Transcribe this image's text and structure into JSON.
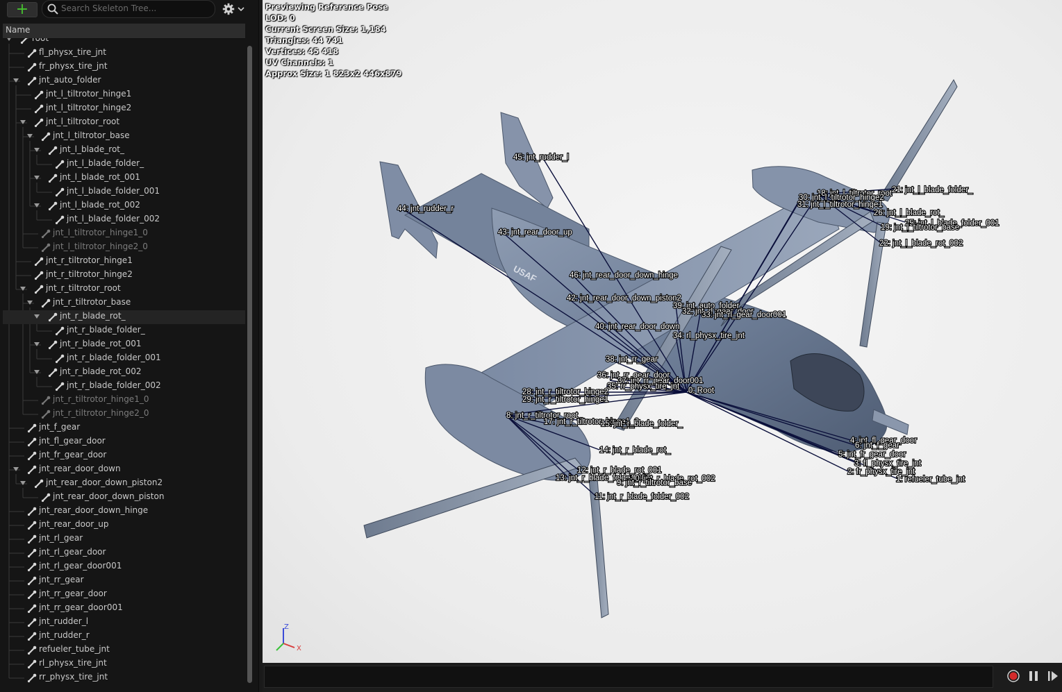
{
  "toolbar": {
    "add_label": "+",
    "search_placeholder": "Search Skeleton Tree...",
    "settings_icon": "gear-icon"
  },
  "tree": {
    "header": "Name",
    "items": [
      {
        "label": "root",
        "depth": 1,
        "caret": true,
        "dim": false
      },
      {
        "label": "fl_physx_tire_jnt",
        "depth": 2,
        "caret": false,
        "dim": false
      },
      {
        "label": "fr_physx_tire_jnt",
        "depth": 2,
        "caret": false,
        "dim": false
      },
      {
        "label": "jnt_auto_folder",
        "depth": 2,
        "caret": true,
        "dim": false
      },
      {
        "label": "jnt_l_tiltrotor_hinge1",
        "depth": 3,
        "caret": false,
        "dim": false
      },
      {
        "label": "jnt_l_tiltrotor_hinge2",
        "depth": 3,
        "caret": false,
        "dim": false
      },
      {
        "label": "jnt_l_tiltrotor_root",
        "depth": 3,
        "caret": true,
        "dim": false
      },
      {
        "label": "jnt_l_tiltrotor_base",
        "depth": 4,
        "caret": true,
        "dim": false
      },
      {
        "label": "jnt_l_blade_rot_",
        "depth": 5,
        "caret": true,
        "dim": false
      },
      {
        "label": "jnt_l_blade_folder_",
        "depth": 6,
        "caret": false,
        "dim": false
      },
      {
        "label": "jnt_l_blade_rot_001",
        "depth": 5,
        "caret": true,
        "dim": false
      },
      {
        "label": "jnt_l_blade_folder_001",
        "depth": 6,
        "caret": false,
        "dim": false
      },
      {
        "label": "jnt_l_blade_rot_002",
        "depth": 5,
        "caret": true,
        "dim": false
      },
      {
        "label": "jnt_l_blade_folder_002",
        "depth": 6,
        "caret": false,
        "dim": false
      },
      {
        "label": "jnt_l_tiltrotor_hinge1_0",
        "depth": 4,
        "caret": false,
        "dim": true
      },
      {
        "label": "jnt_l_tiltrotor_hinge2_0",
        "depth": 4,
        "caret": false,
        "dim": true
      },
      {
        "label": "jnt_r_tiltrotor_hinge1",
        "depth": 3,
        "caret": false,
        "dim": false
      },
      {
        "label": "jnt_r_tiltrotor_hinge2",
        "depth": 3,
        "caret": false,
        "dim": false
      },
      {
        "label": "jnt_r_tiltrotor_root",
        "depth": 3,
        "caret": true,
        "dim": false
      },
      {
        "label": "jnt_r_tiltrotor_base",
        "depth": 4,
        "caret": true,
        "dim": false
      },
      {
        "label": "jnt_r_blade_rot_",
        "depth": 5,
        "caret": true,
        "dim": false,
        "selected": true
      },
      {
        "label": "jnt_r_blade_folder_",
        "depth": 6,
        "caret": false,
        "dim": false
      },
      {
        "label": "jnt_r_blade_rot_001",
        "depth": 5,
        "caret": true,
        "dim": false
      },
      {
        "label": "jnt_r_blade_folder_001",
        "depth": 6,
        "caret": false,
        "dim": false
      },
      {
        "label": "jnt_r_blade_rot_002",
        "depth": 5,
        "caret": true,
        "dim": false
      },
      {
        "label": "jnt_r_blade_folder_002",
        "depth": 6,
        "caret": false,
        "dim": false
      },
      {
        "label": "jnt_r_tiltrotor_hinge1_0",
        "depth": 4,
        "caret": false,
        "dim": true
      },
      {
        "label": "jnt_r_tiltrotor_hinge2_0",
        "depth": 4,
        "caret": false,
        "dim": true
      },
      {
        "label": "jnt_f_gear",
        "depth": 2,
        "caret": false,
        "dim": false
      },
      {
        "label": "jnt_fl_gear_door",
        "depth": 2,
        "caret": false,
        "dim": false
      },
      {
        "label": "jnt_fr_gear_door",
        "depth": 2,
        "caret": false,
        "dim": false
      },
      {
        "label": "jnt_rear_door_down",
        "depth": 2,
        "caret": true,
        "dim": false
      },
      {
        "label": "jnt_rear_door_down_piston2",
        "depth": 3,
        "caret": true,
        "dim": false
      },
      {
        "label": "jnt_rear_door_down_piston",
        "depth": 4,
        "caret": false,
        "dim": false
      },
      {
        "label": "jnt_rear_door_down_hinge",
        "depth": 2,
        "caret": false,
        "dim": false
      },
      {
        "label": "jnt_rear_door_up",
        "depth": 2,
        "caret": false,
        "dim": false
      },
      {
        "label": "jnt_rl_gear",
        "depth": 2,
        "caret": false,
        "dim": false
      },
      {
        "label": "jnt_rl_gear_door",
        "depth": 2,
        "caret": false,
        "dim": false
      },
      {
        "label": "jnt_rl_gear_door001",
        "depth": 2,
        "caret": false,
        "dim": false
      },
      {
        "label": "jnt_rr_gear",
        "depth": 2,
        "caret": false,
        "dim": false
      },
      {
        "label": "jnt_rr_gear_door",
        "depth": 2,
        "caret": false,
        "dim": false
      },
      {
        "label": "jnt_rr_gear_door001",
        "depth": 2,
        "caret": false,
        "dim": false
      },
      {
        "label": "jnt_rudder_l",
        "depth": 2,
        "caret": false,
        "dim": false
      },
      {
        "label": "jnt_rudder_r",
        "depth": 2,
        "caret": false,
        "dim": false
      },
      {
        "label": "refueler_tube_jnt",
        "depth": 2,
        "caret": false,
        "dim": false
      },
      {
        "label": "rl_physx_tire_jnt",
        "depth": 2,
        "caret": false,
        "dim": false
      },
      {
        "label": "rr_physx_tire_jnt",
        "depth": 2,
        "caret": false,
        "dim": false
      }
    ]
  },
  "viewport": {
    "stats": [
      "Previewing Reference Pose",
      "LOD: 0",
      "Current Screen Size: 1,184",
      "Triangles: 44 741",
      "Vertices: 45 418",
      "UV Channels: 1",
      "Approx Size: 1 823x2 446x879"
    ],
    "bone_labels": [
      "45: jnt_rudder_l",
      "44: jnt_rudder_r",
      "43: jnt_rear_door_up",
      "46: jnt_rear_door_down_hinge",
      "42: jnt_rear_door_down_piston2",
      "40: jnt_rear_door_down",
      "39: jnt_auto_folder",
      "32: jnt_rl_gear_door",
      "33: jnt_rl_gear_door001",
      "34: rl_physx_tire_jnt",
      "38: jnt_rr_gear",
      "36: jnt_rr_gear_door",
      "37: jnt_rr_gear_door001",
      "35: rr_physx_tire_jnt",
      "0: Root",
      "28: jnt_r_tiltrotor_hinge2",
      "29: jnt_r_tiltrotor_hinge1",
      "8: jnt_r_tiltrotor_root",
      "17: jnt_r_tiltrotor_hinge1_0",
      "15: jnt_r_blade_folder_",
      "14: jnt_r_blade_rot_",
      "12: jnt_r_blade_rot_001",
      "13: jnt_r_blade_folder_001",
      "10: jnt_r_blade_rot_002",
      "9: jnt_r_tiltrotor_base",
      "11: jnt_r_blade_folder_002",
      "18: jnt_l_tiltrotor_root",
      "30: jnt_l_tiltrotor_hinge2",
      "31: jnt_l_tiltrotor_hinge1",
      "21: jnt_l_blade_folder_",
      "26: jnt_l_blade_rot_",
      "25: jnt_l_blade_folder_001",
      "19: jnt_l_tiltrotor_base",
      "22: jnt_l_blade_rot_002",
      "23: jnt_l_blade_folder_002",
      "4: jnt_fl_gear_door",
      "6: jnt_f_gear",
      "5: jnt_fr_gear_door",
      "3: fl_physx_tire_jnt",
      "2: fr_physx_tire_jnt",
      "1: refueler_tube_jnt",
      "USAF"
    ],
    "axis": {
      "z": "Z",
      "x": "X"
    }
  },
  "playback": {
    "record_icon": "record-icon",
    "pause_icon": "pause-icon",
    "step_icon": "step-forward-icon"
  }
}
